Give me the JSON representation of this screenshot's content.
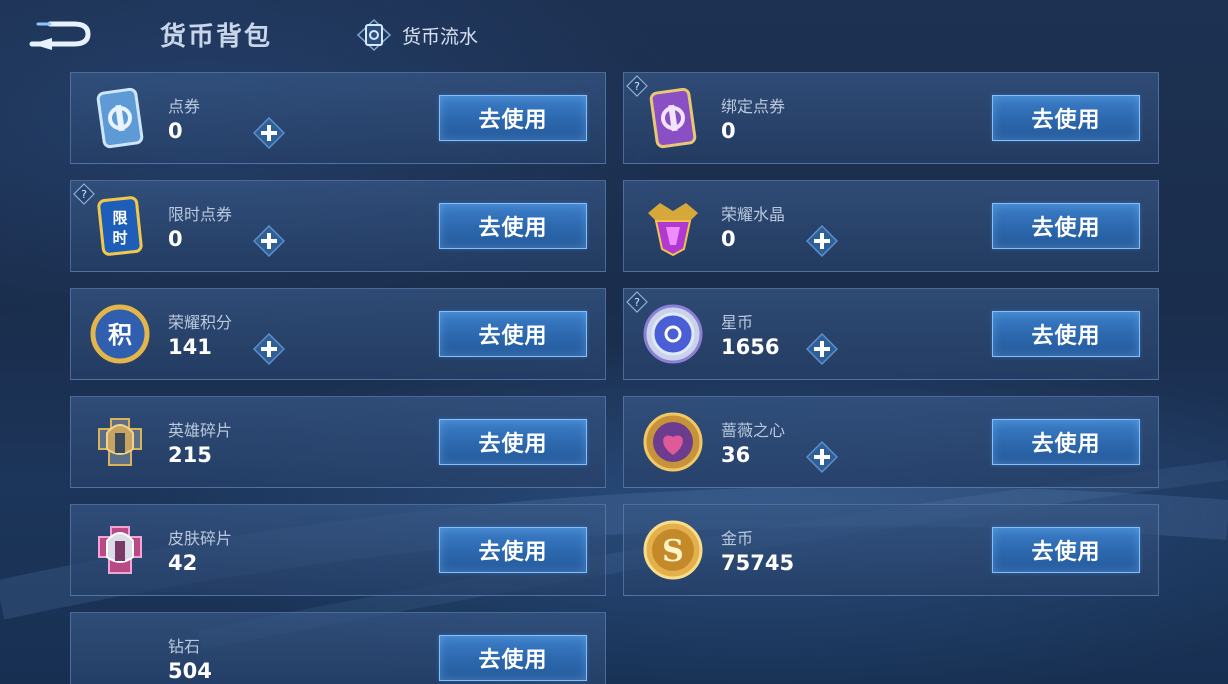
{
  "header": {
    "title": "货币背包",
    "flow_label": "货币流水"
  },
  "use_label": "去使用",
  "cards": [
    {
      "name": "点券",
      "amount": "0",
      "icon": "blue-coupon-icon"
    },
    {
      "name": "绑定点券",
      "amount": "0",
      "icon": "purple-coupon-icon"
    },
    {
      "name": "限时点券",
      "amount": "0",
      "icon": "limited-coupon-icon"
    },
    {
      "name": "荣耀水晶",
      "amount": "0",
      "icon": "glory-crystal-icon"
    },
    {
      "name": "荣耀积分",
      "amount": "141",
      "icon": "glory-points-icon"
    },
    {
      "name": "星币",
      "amount": "1656",
      "icon": "star-coin-icon"
    },
    {
      "name": "英雄碎片",
      "amount": "215",
      "icon": "hero-fragment-icon"
    },
    {
      "name": "蔷薇之心",
      "amount": "36",
      "icon": "rose-heart-icon"
    },
    {
      "name": "皮肤碎片",
      "amount": "42",
      "icon": "skin-fragment-icon"
    },
    {
      "name": "金币",
      "amount": "75745",
      "icon": "gold-coin-icon"
    },
    {
      "name": "钻石",
      "amount": "504",
      "icon": "diamond-icon"
    }
  ]
}
